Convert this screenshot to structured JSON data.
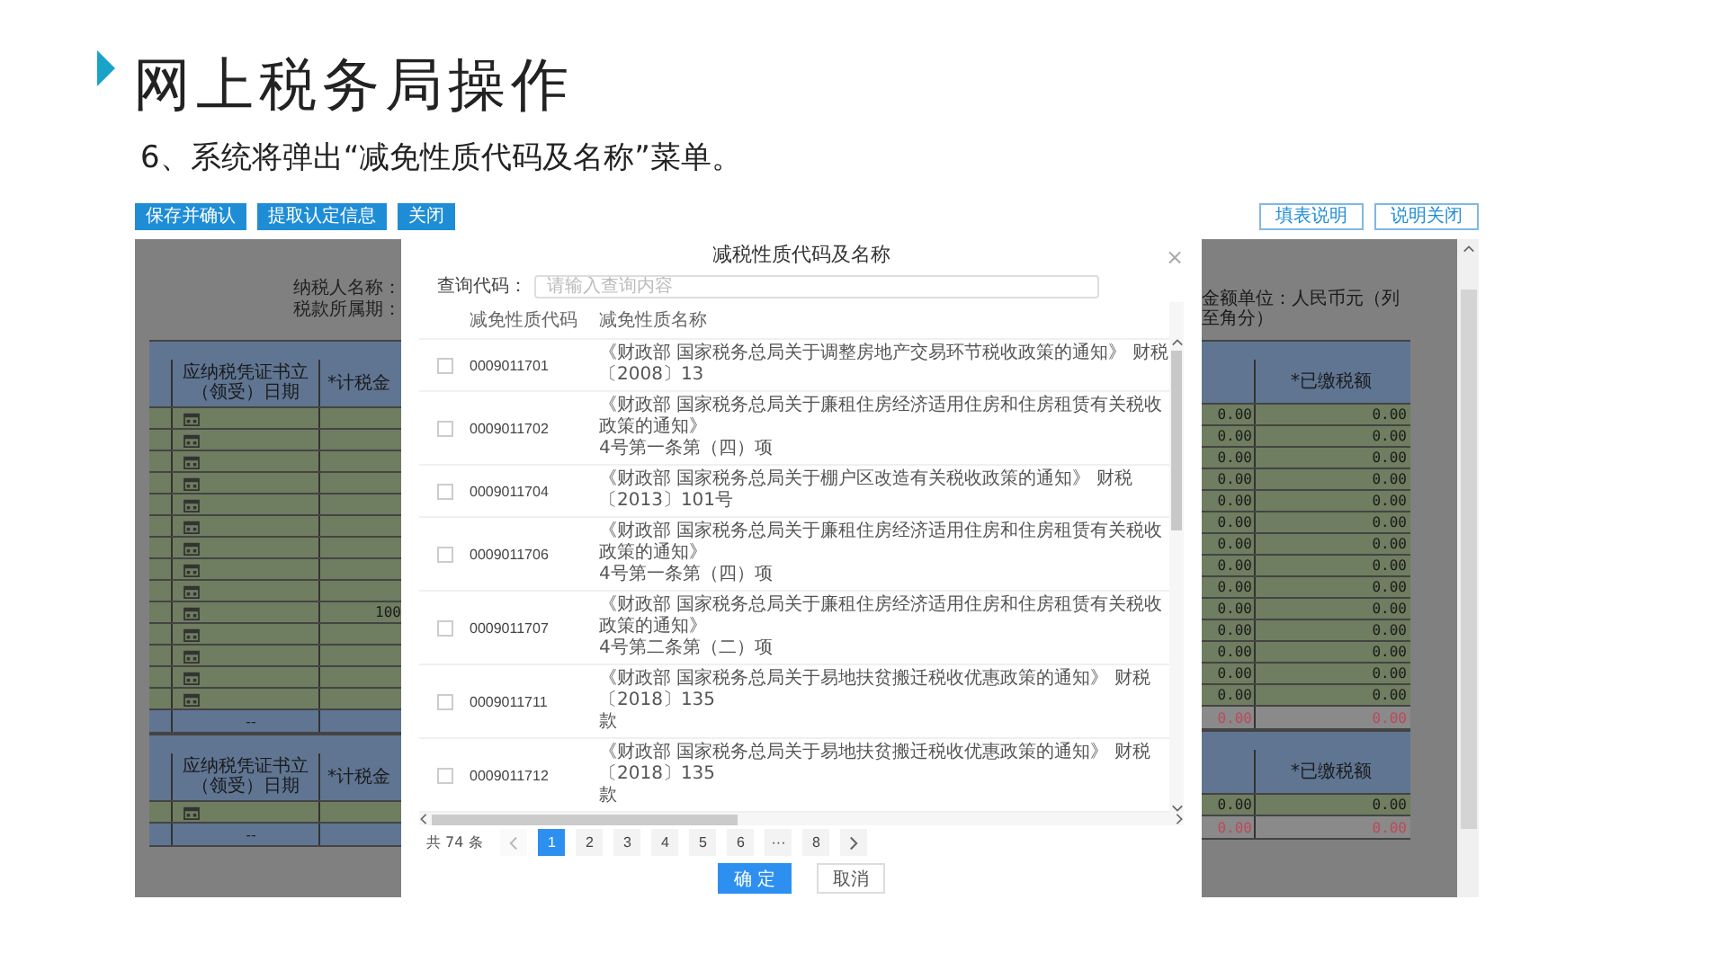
{
  "slide": {
    "title": "网上税务局操作",
    "subtitle": "6、系统将弹出“减免性质代码及名称”菜单。"
  },
  "toolbar": {
    "left_buttons": [
      "保存并确认",
      "提取认定信息",
      "关闭"
    ],
    "right_buttons": [
      "填表说明",
      "说明关闭"
    ]
  },
  "form": {
    "taxpayer_labels": [
      "纳税人名称：",
      "税款所属期："
    ],
    "unit_note": "金额单位：人民币元（列至角分）",
    "sections": [
      {
        "left_headers": [
          "应纳税凭证书立（领受）日期",
          "*计税金"
        ],
        "right_header": "*已缴税额",
        "rows": [
          {
            "kind": "entry",
            "values": [
              "0.00",
              "0.00"
            ]
          },
          {
            "kind": "entry",
            "values": [
              "0.00",
              "0.00"
            ]
          },
          {
            "kind": "entry",
            "values": [
              "0.00",
              "0.00"
            ]
          },
          {
            "kind": "entry",
            "values": [
              "0.00",
              "0.00"
            ]
          },
          {
            "kind": "entry",
            "values": [
              "0.00",
              "0.00"
            ]
          },
          {
            "kind": "entry",
            "values": [
              "0.00",
              "0.00"
            ]
          },
          {
            "kind": "entry",
            "values": [
              "0.00",
              "0.00"
            ]
          },
          {
            "kind": "entry",
            "values": [
              "0.00",
              "0.00"
            ]
          },
          {
            "kind": "entry",
            "values": [
              "0.00",
              "0.00"
            ]
          },
          {
            "kind": "entry",
            "amount": "100",
            "values": [
              "0.00",
              "0.00"
            ]
          },
          {
            "kind": "entry",
            "values": [
              "0.00",
              "0.00"
            ]
          },
          {
            "kind": "entry",
            "values": [
              "0.00",
              "0.00"
            ]
          },
          {
            "kind": "entry",
            "values": [
              "0.00",
              "0.00"
            ]
          },
          {
            "kind": "entry",
            "values": [
              "0.00",
              "0.00"
            ]
          },
          {
            "kind": "total",
            "label": "--",
            "values": [
              "0.00",
              "0.00"
            ]
          }
        ]
      },
      {
        "left_headers": [
          "应纳税凭证书立（领受）日期",
          "*计税金"
        ],
        "right_header": "*已缴税额",
        "rows": [
          {
            "kind": "entry",
            "values": [
              "0.00",
              "0.00"
            ]
          },
          {
            "kind": "total",
            "label": "--",
            "values": [
              "0.00",
              "0.00"
            ]
          }
        ]
      }
    ]
  },
  "dialog": {
    "title": "减税性质代码及名称",
    "close": "×",
    "search": {
      "label": "查询代码：",
      "placeholder": "请输入查询内容"
    },
    "columns": [
      "减免性质代码",
      "减免性质名称"
    ],
    "rows": [
      {
        "checked": false,
        "code": "0009011701",
        "name": [
          "《财政部 国家税务总局关于调整房地产交易环节税收政策的通知》 财税〔2008〕13"
        ]
      },
      {
        "checked": false,
        "code": "0009011702",
        "name": [
          "《财政部 国家税务总局关于廉租住房经济适用住房和住房租赁有关税收政策的通知》",
          "4号第一条第（四）项"
        ]
      },
      {
        "checked": false,
        "code": "0009011704",
        "name": [
          "《财政部 国家税务总局关于棚户区改造有关税收政策的通知》 财税〔2013〕101号"
        ]
      },
      {
        "checked": false,
        "code": "0009011706",
        "name": [
          "《财政部 国家税务总局关于廉租住房经济适用住房和住房租赁有关税收政策的通知》",
          "4号第一条第（四）项"
        ]
      },
      {
        "checked": false,
        "code": "0009011707",
        "name": [
          "《财政部 国家税务总局关于廉租住房经济适用住房和住房租赁有关税收政策的通知》",
          "4号第二条第（二）项"
        ]
      },
      {
        "checked": false,
        "code": "0009011711",
        "name": [
          "《财政部 国家税务总局关于易地扶贫搬迁税收优惠政策的通知》 财税〔2018〕135",
          "款"
        ]
      },
      {
        "checked": false,
        "code": "0009011712",
        "name": [
          "《财政部 国家税务总局关于易地扶贫搬迁税收优惠政策的通知》 财税〔2018〕135",
          "款"
        ]
      }
    ],
    "pagination": {
      "total": "共 74 条",
      "pages": [
        {
          "label": "1",
          "selected": true
        },
        {
          "label": "2",
          "selected": false
        },
        {
          "label": "3",
          "selected": false
        },
        {
          "label": "4",
          "selected": false
        },
        {
          "label": "5",
          "selected": false
        },
        {
          "label": "6",
          "selected": false
        },
        {
          "label": "···",
          "selected": false
        },
        {
          "label": "8",
          "selected": false
        }
      ]
    },
    "buttons": [
      {
        "label": "确 定",
        "kind": "primary"
      },
      {
        "label": "取消",
        "kind": "default"
      }
    ]
  }
}
